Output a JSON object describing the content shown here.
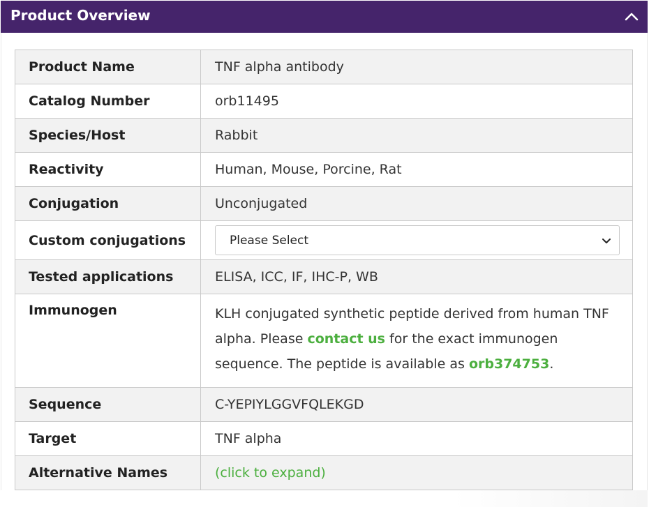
{
  "header": {
    "title": "Product Overview",
    "collapse_icon": "chevron-up-icon",
    "background_color": "#45246b"
  },
  "rows": {
    "product_name": {
      "label": "Product Name",
      "value": "TNF alpha antibody"
    },
    "catalog_number": {
      "label": "Catalog Number",
      "value": "orb11495"
    },
    "species_host": {
      "label": "Species/Host",
      "value": "Rabbit"
    },
    "reactivity": {
      "label": "Reactivity",
      "value": "Human, Mouse, Porcine, Rat"
    },
    "conjugation": {
      "label": "Conjugation",
      "value": "Unconjugated"
    },
    "custom_conjugations": {
      "label": "Custom conjugations",
      "select_value": "Please Select",
      "select_icon": "chevron-down-icon"
    },
    "tested_applications": {
      "label": "Tested applications",
      "value": "ELISA, ICC, IF, IHC-P, WB"
    },
    "immunogen": {
      "label": "Immunogen",
      "text_part1": "KLH conjugated synthetic peptide derived from human TNF alpha. Please ",
      "link_contact": "contact us",
      "text_part2": " for the exact immunogen sequence. The peptide is available as ",
      "link_peptide": "orb374753",
      "text_part3": "."
    },
    "sequence": {
      "label": "Sequence",
      "value": "C-YEPIYLGGVFQLEKGD"
    },
    "target": {
      "label": "Target",
      "value": "TNF alpha"
    },
    "alternative_names": {
      "label": "Alternative Names",
      "link": "(click to expand)"
    }
  },
  "colors": {
    "link_green": "#4caf3f",
    "row_alt": "#f2f2f2",
    "border": "#c9c9c9"
  }
}
